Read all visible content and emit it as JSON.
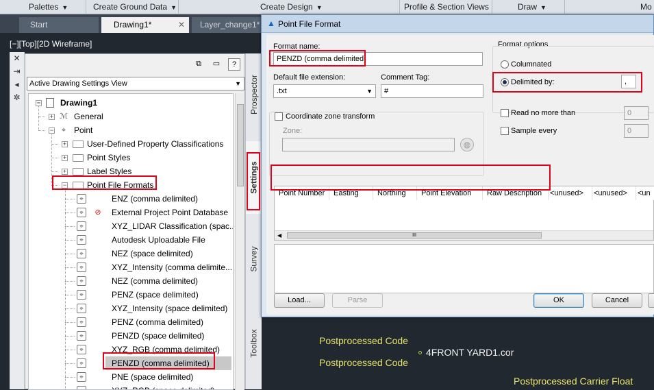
{
  "ribbon": {
    "palettes": "Palettes",
    "create_ground_data": "Create Ground Data",
    "create_design": "Create Design",
    "profile_section_views": "Profile & Section Views",
    "draw": "Draw",
    "modify_partial": "Mo"
  },
  "tabs": {
    "start": "Start",
    "drawing1": "Drawing1*",
    "layer_change": "Layer_change1*"
  },
  "viewport_label": "[−][Top][2D Wireframe]",
  "toolspace": {
    "view_dropdown": "Active Drawing Settings View",
    "tree": {
      "drawing": "Drawing1",
      "general": "General",
      "point": "Point",
      "udpc": "User-Defined Property Classifications",
      "point_styles": "Point Styles",
      "label_styles": "Label Styles",
      "point_file_formats": "Point File Formats",
      "formats": [
        "ENZ (comma delimited)",
        "External Project Point Database",
        "XYZ_LIDAR Classification (spac...",
        "Autodesk Uploadable File",
        "NEZ (space delimited)",
        "XYZ_Intensity (comma delimite...",
        "NEZ (comma delimited)",
        "PENZ (space delimited)",
        "XYZ_Intensity (space delimited)",
        "PENZ (comma delimited)",
        "PENZD (space delimited)",
        "XYZ_RGB (comma delimited)",
        "PENZD (comma delimited)",
        "PNE (space delimited)",
        "XYZ_RGB (space delimited)"
      ]
    },
    "side_tabs": [
      "Prospector",
      "Settings",
      "Survey",
      "Toolbox"
    ]
  },
  "dialog": {
    "title": "Point File Format",
    "format_name_label": "Format name:",
    "format_name_value": "PENZD (comma delimited)",
    "ext_label": "Default file extension:",
    "ext_value": ".txt",
    "comment_tag_label": "Comment Tag:",
    "comment_tag_value": "#",
    "coord_zone_label": "Coordinate zone transform",
    "zone_label": "Zone:",
    "format_options_label": "Format options",
    "columnated_label": "Columnated",
    "delimited_label": "Delimited by:",
    "delimiter_value": ",",
    "read_no_more_label": "Read no more than",
    "read_no_more_value": "0",
    "sample_every_label": "Sample every",
    "sample_every_value": "0",
    "columns": [
      "Point Number",
      "Easting",
      "Northing",
      "Point Elevation",
      "Raw Description",
      "<unused>",
      "<unused>",
      "<un"
    ],
    "hscroll_grip": "III",
    "load_button": "Load...",
    "parse_button": "Parse",
    "ok_button": "OK",
    "cancel_button": "Cancel"
  },
  "canvas_text": {
    "postprocessed_code_1": "Postprocessed Code",
    "front_yard": "4FRONT YARD1.cor",
    "postprocessed_code_2": "Postprocessed Code",
    "carrier_float": "Postprocessed Carrier Float"
  }
}
